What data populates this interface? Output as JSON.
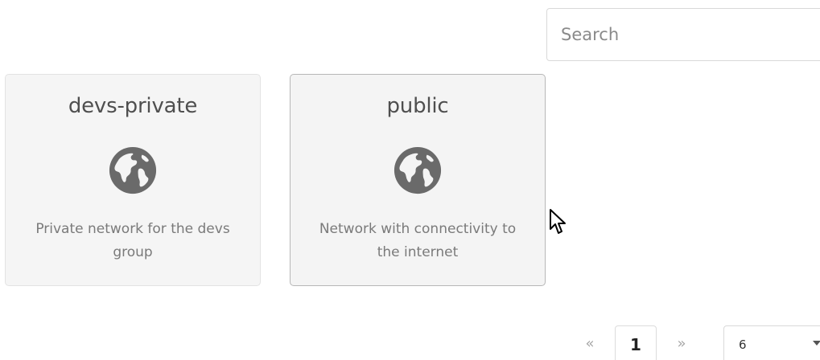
{
  "search": {
    "placeholder": "Search",
    "value": ""
  },
  "networks": [
    {
      "name": "devs-private",
      "icon": "globe-icon",
      "description": "Private network for the devs group"
    },
    {
      "name": "public",
      "icon": "globe-icon",
      "description": "Network with connectivity to the internet"
    }
  ],
  "pagination": {
    "prev_label": "«",
    "current_page": "1",
    "next_label": "»"
  },
  "per_page": {
    "selected": "6"
  },
  "colors": {
    "card_bg": "#f5f5f5",
    "icon_color": "#666666",
    "text_muted": "#7a7a7a"
  }
}
